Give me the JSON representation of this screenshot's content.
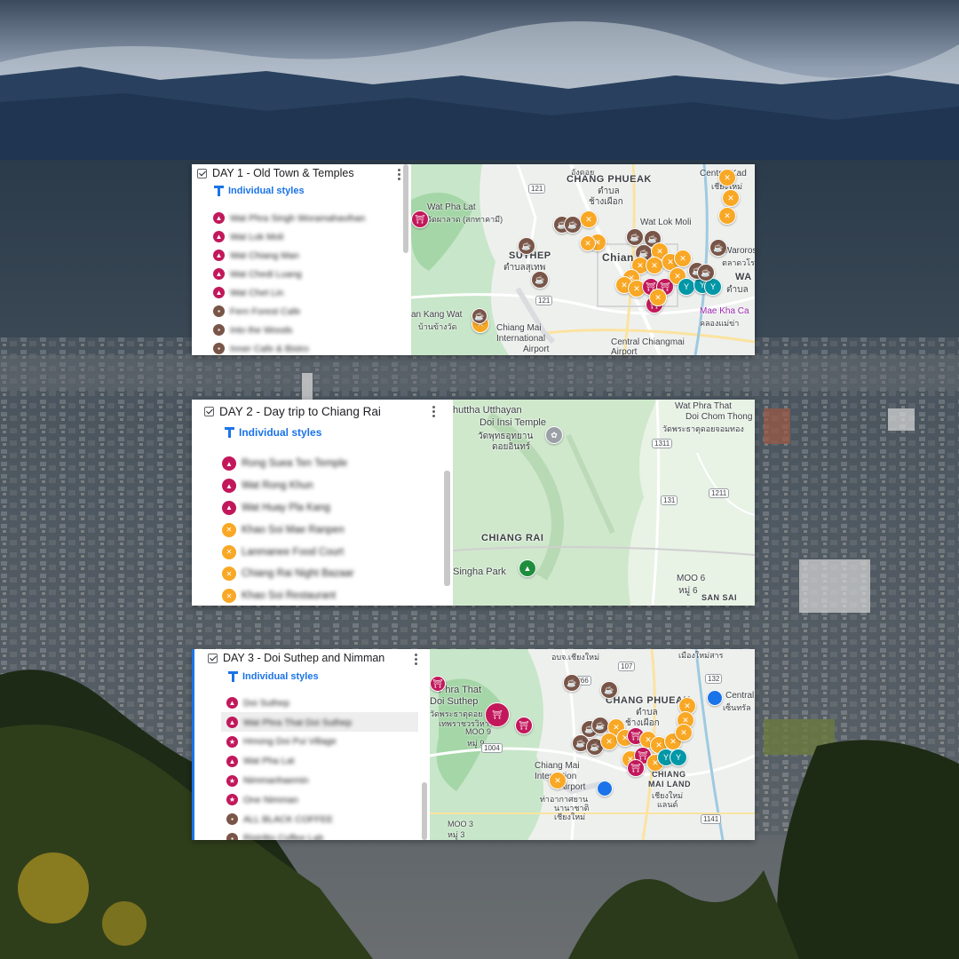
{
  "colors": {
    "temple": "#c2185b",
    "cafe": "#795548",
    "food": "#f9a825",
    "bar": "#0097a7",
    "shop": "#9c27b0",
    "airport": "#1a73e8",
    "park": "#1e8e3e"
  },
  "icons": {
    "checkbox": "checkbox-icon",
    "more": "more-vert-icon",
    "style": "individual-styles-icon",
    "temple": "temple-icon",
    "cafe": "coffee-icon",
    "food": "fork-knife-icon",
    "star": "star-icon",
    "bar": "cocktail-icon"
  },
  "cards": [
    {
      "title": "DAY 1 - Old Town & Temples",
      "styles_label": "Individual styles",
      "items": [
        {
          "label": "Wat Phra Singh Woramahavihan",
          "type": "temple"
        },
        {
          "label": "Wat Lok Moli",
          "type": "temple"
        },
        {
          "label": "Wat Chiang Man",
          "type": "temple"
        },
        {
          "label": "Wat Chedi Luang",
          "type": "temple"
        },
        {
          "label": "Wat Chet Lin",
          "type": "temple"
        },
        {
          "label": "Fern Forest Cafe",
          "type": "cafe"
        },
        {
          "label": "Into the Woods",
          "type": "cafe"
        },
        {
          "label": "Inner Cafe & Bistro",
          "type": "cafe"
        }
      ],
      "map_labels": [
        {
          "text": "CHANG PHUEAK",
          "big": true
        },
        {
          "text": "ตำบล",
          "big": false
        },
        {
          "text": "ช้างเผือก",
          "big": false
        },
        {
          "text": "Wat Pha Lat",
          "big": false
        },
        {
          "text": "วัดผาลาด (สกทาคามี)",
          "big": false
        },
        {
          "text": "SUTHEP",
          "big": true
        },
        {
          "text": "ตำบลสุเทพ",
          "big": false
        },
        {
          "text": "Wat Lok Moli",
          "big": false
        },
        {
          "text": "Central Kad",
          "big": false
        },
        {
          "text": "Waroros",
          "big": false
        },
        {
          "text": "ตลาดวโร",
          "big": false
        },
        {
          "text": "Chian",
          "big": true
        },
        {
          "text": "WA",
          "big": true
        },
        {
          "text": "ตำบล",
          "big": false
        },
        {
          "text": "an Kang Wat",
          "big": false
        },
        {
          "text": "บ้านข้างวัด",
          "big": false
        },
        {
          "text": "Chiang Mai",
          "big": false
        },
        {
          "text": "International",
          "big": false
        },
        {
          "text": "Airport",
          "big": false
        },
        {
          "text": "Mae Kha Ca",
          "big": false
        },
        {
          "text": "คลองแม่ข่า",
          "big": false
        },
        {
          "text": "Central Chiangmai",
          "big": false
        },
        {
          "text": "Airport",
          "big": false
        },
        {
          "text": "อังดอย",
          "big": false
        },
        {
          "text": "เชียงใหม่",
          "big": false
        }
      ],
      "shields": [
        "121",
        "121"
      ]
    },
    {
      "title": "DAY 2 - Day trip to Chiang Rai",
      "styles_label": "Individual styles",
      "items": [
        {
          "label": "Rong Suea Ten Temple",
          "type": "temple"
        },
        {
          "label": "Wat Rong Khun",
          "type": "temple"
        },
        {
          "label": "Wat Huay Pla Kang",
          "type": "temple"
        },
        {
          "label": "Khao Soi Mae Ranpen",
          "type": "food"
        },
        {
          "label": "Lanmanee Food Court",
          "type": "food"
        },
        {
          "label": "Chiang Rai Night Bazaar",
          "type": "food"
        },
        {
          "label": "Khao Soi Restaurant",
          "type": "food"
        }
      ],
      "map_labels": [
        {
          "text": "huttha Utthayan",
          "big": false
        },
        {
          "text": "Doi Insi Temple",
          "big": false
        },
        {
          "text": "วัดพุทธอุทยาน",
          "big": false
        },
        {
          "text": "ดอยอินทร์",
          "big": false
        },
        {
          "text": "Wat Phra That",
          "big": false
        },
        {
          "text": "Doi Chom Thong",
          "big": false
        },
        {
          "text": "วัดพระธาตุดอยจอมทอง",
          "big": false
        },
        {
          "text": "CHIANG RAI",
          "big": true
        },
        {
          "text": "Singha Park",
          "big": false
        },
        {
          "text": "MOO 6",
          "big": false
        },
        {
          "text": "หมู่ 6",
          "big": false
        },
        {
          "text": "SAN SAI",
          "big": true
        }
      ],
      "shields": [
        "1311",
        "1211",
        "131"
      ]
    },
    {
      "title": "DAY 3 - Doi Suthep and Nimman",
      "styles_label": "Individual styles",
      "items": [
        {
          "label": "Doi Suthep",
          "type": "temple"
        },
        {
          "label": "Wat Phra That Doi Suthep",
          "type": "temple"
        },
        {
          "label": "Hmong Doi Pui Village",
          "type": "star"
        },
        {
          "label": "Wat Pha Lat",
          "type": "temple"
        },
        {
          "label": "Nimmanhaemin",
          "type": "star"
        },
        {
          "label": "One Nimman",
          "type": "star"
        },
        {
          "label": "ALL BLACK COFFEE",
          "type": "cafe"
        },
        {
          "label": "Ristr8to Coffee Lab",
          "type": "cafe"
        }
      ],
      "map_labels": [
        {
          "text": "อบจ.เชียงใหม่",
          "big": false
        },
        {
          "text": "Phra That",
          "big": false
        },
        {
          "text": "Doi Suthep",
          "big": false
        },
        {
          "text": "วัดพระธาตุดอย",
          "big": false
        },
        {
          "text": "เทพราชวรวิหาร",
          "big": false
        },
        {
          "text": "MOO 9",
          "big": false
        },
        {
          "text": "หมู่ 9",
          "big": false
        },
        {
          "text": "CHANG PHUEAK",
          "big": true
        },
        {
          "text": "ตำบล",
          "big": false
        },
        {
          "text": "ช้างเผือก",
          "big": false
        },
        {
          "text": "Central",
          "big": false
        },
        {
          "text": "เซ็นทรัล",
          "big": false
        },
        {
          "text": "Chiang Mai",
          "big": false
        },
        {
          "text": "Internation",
          "big": false
        },
        {
          "text": "Airport",
          "big": false
        },
        {
          "text": "ท่าอากาศยาน",
          "big": false
        },
        {
          "text": "นานาชาติ",
          "big": false
        },
        {
          "text": "เชียงใหม่",
          "big": false
        },
        {
          "text": "CHIANG",
          "big": true
        },
        {
          "text": "MAI LAND",
          "big": true
        },
        {
          "text": "เชียงใหม่",
          "big": false
        },
        {
          "text": "แลนด์",
          "big": false
        },
        {
          "text": "MOO 3",
          "big": false
        },
        {
          "text": "หมู่ 3",
          "big": false
        },
        {
          "text": "เมืองใหม่สาร",
          "big": false
        }
      ],
      "shields": [
        "1366",
        "107",
        "132",
        "1004",
        "1141"
      ]
    }
  ]
}
